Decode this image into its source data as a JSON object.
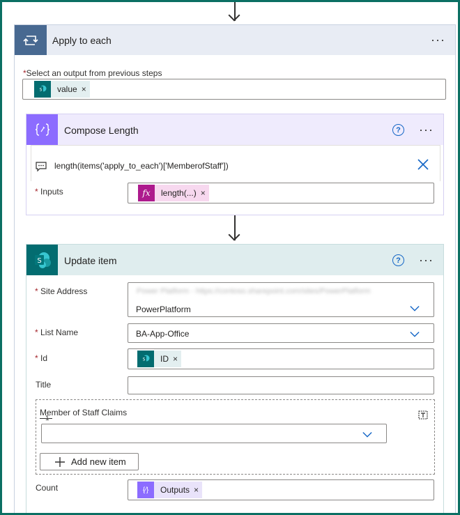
{
  "apply_to_each": {
    "title": "Apply to each",
    "select_label": "Select an output from previous steps",
    "token": "value"
  },
  "compose": {
    "title": "Compose Length",
    "expression": "length(items('apply_to_each')['MemberofStaff'])",
    "inputs_label": "Inputs",
    "inputs_token": "length(...)"
  },
  "update_item": {
    "title": "Update item",
    "site_address_label": "Site Address",
    "site_address_blurred": "Power Platform - https://contoso.sharepoint.com/sites/PowerPlatform",
    "site_address_value": "PowerPlatform",
    "list_name_label": "List Name",
    "list_name_value": "BA-App-Office",
    "id_label": "Id",
    "id_token": "ID",
    "title_label": "Title",
    "claims_label": "Member of Staff Claims",
    "claims_index": "1",
    "add_new_item": "Add new item",
    "count_label": "Count",
    "count_token": "Outputs"
  },
  "common": {
    "more_dots": "···",
    "help": "?",
    "required_mark": "*",
    "remove_x": "×"
  },
  "colors": {
    "frame": "#0b6f63",
    "apply_to_each_accent": "#486991",
    "compose_accent": "#8c6cff",
    "sharepoint_accent": "#036c70",
    "expression_accent": "#ad1a8d",
    "link_blue": "#1466c6"
  }
}
